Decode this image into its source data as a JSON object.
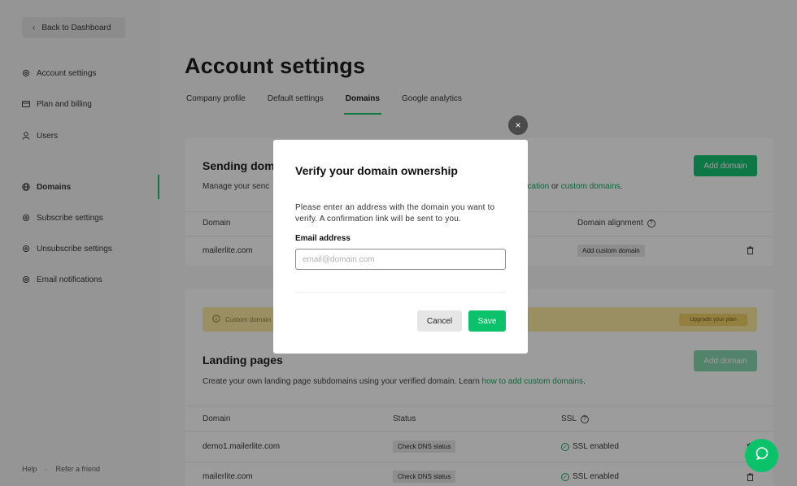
{
  "sidebar": {
    "back_label": "Back to Dashboard",
    "items": [
      {
        "label": "Account settings",
        "icon": "gear-icon"
      },
      {
        "label": "Plan and billing",
        "icon": "card-icon"
      },
      {
        "label": "Users",
        "icon": "user-icon"
      },
      {
        "label": "Domains",
        "icon": "globe-icon",
        "active": true
      },
      {
        "label": "Subscribe settings",
        "icon": "gear-icon"
      },
      {
        "label": "Unsubscribe settings",
        "icon": "gear-icon"
      },
      {
        "label": "Email notifications",
        "icon": "gear-icon"
      }
    ],
    "footer": {
      "help": "Help",
      "sep": "·",
      "refer": "Refer a friend"
    }
  },
  "main": {
    "title": "Account settings",
    "tabs": [
      "Company profile",
      "Default settings",
      "Domains",
      "Google analytics"
    ],
    "sending": {
      "title": "Sending dom",
      "desc_start": "Manage your senc",
      "desc_link1": "ntication",
      "desc_or": " or ",
      "desc_link2": "custom domains",
      "desc_end": ".",
      "add_button": "Add domain",
      "headers": {
        "domain": "Domain",
        "alignment": "Domain alignment"
      },
      "rows": [
        {
          "domain": "mailerlite.com",
          "alignment": "Add custom domain"
        }
      ]
    },
    "landing": {
      "warning_text": "Custom domain",
      "warning_button": "Upgrade your plan",
      "title": "Landing pages",
      "desc": "Create your own landing page subdomains using your verified domain. Learn ",
      "desc_link": "how to add custom domains",
      "desc_end": ".",
      "add_button": "Add domain",
      "headers": {
        "domain": "Domain",
        "status": "Status",
        "ssl": "SSL"
      },
      "rows": [
        {
          "domain": "demo1.mailerlite.com",
          "status": "Check DNS status",
          "ssl": "SSL enabled"
        },
        {
          "domain": "mailerlite.com",
          "status": "Check DNS status",
          "ssl": "SSL enabled"
        }
      ]
    }
  },
  "modal": {
    "title": "Verify your domain ownership",
    "text": "Please enter an address with the domain you want to verify. A confirmation link will be sent to you.",
    "label": "Email address",
    "placeholder": "email@domain.com",
    "cancel": "Cancel",
    "save": "Save",
    "close": "×"
  },
  "colors": {
    "accent": "#09c269",
    "overlay": "rgba(20,20,20,0.42)",
    "warning": "#fce89b"
  }
}
